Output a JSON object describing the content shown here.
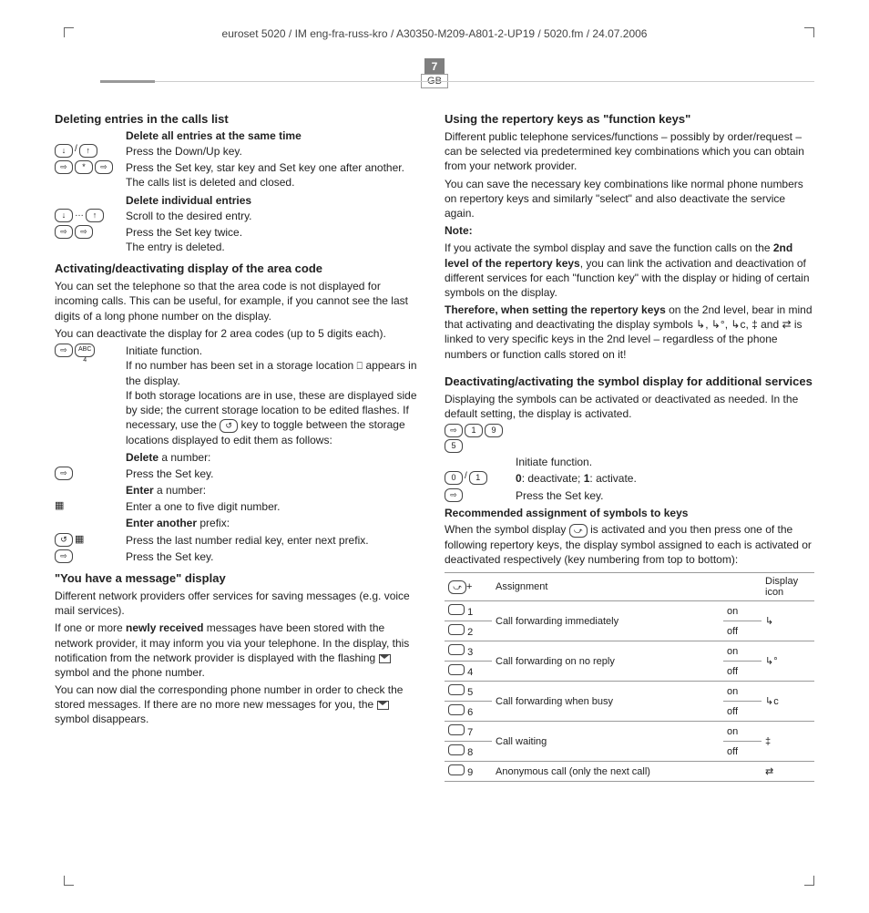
{
  "header": "euroset 5020 / IM eng-fra-russ-kro / A30350-M209-A801-2-UP19 / 5020.fm / 24.07.2006",
  "page_number": "7",
  "region": "GB",
  "left": {
    "h1": "Deleting entries in the calls list",
    "sub1": "Delete all entries at the same time",
    "r1d": "Press the Down/Up key.",
    "r2d": "Press the Set key, star key and Set key one after another.",
    "r2e": "The calls list is deleted and closed.",
    "sub2": "Delete individual entries",
    "r3d": "Scroll to the desired entry.",
    "r4d": "Press the Set key twice.",
    "r4e": "The entry is deleted.",
    "h2": "Activating/deactivating display of the area code",
    "p1": "You can set the telephone so that the area code is not displayed for incoming calls. This can be useful, for example, if you cannot see the last digits of a long phone number on the display.",
    "p2": "You can deactivate the display for 2 area codes (up to 5 digits each).",
    "r5d": "Initiate function.",
    "r5e1": "If no number has been set in a storage location",
    "r5e1b": "appears in the display.",
    "r5e2": "If both storage locations are in use, these are displayed side by side; the current storage location to be edited flashes. If necessary, use the",
    "r5e2b": "key to toggle between the storage locations displayed to edit them as follows:",
    "sub3": "Delete",
    "sub3b": " a number:",
    "r6d": "Press the Set key.",
    "sub4": "Enter",
    "sub4b": " a number:",
    "r7d": "Enter a one to five digit number.",
    "sub5": "Enter another",
    "sub5b": " prefix:",
    "r8d": "Press the last number redial key, enter next prefix.",
    "r9d": "Press the Set key.",
    "h3": "\"You have a message\" display",
    "p3": "Different network providers offer services for saving messages (e.g. voice mail services).",
    "p4a": "If one or more ",
    "p4b": "newly received",
    "p4c": " messages have been stored with the network provider, it may inform you via your telephone. In the display, this notification from the network provider is displayed with the flashing ",
    "p4d": " symbol and the phone number.",
    "p5a": "You can now dial the corresponding phone number in order to check the stored messages. If there are no more new messages for you, the ",
    "p5b": " symbol disappears."
  },
  "right": {
    "h1": "Using the repertory keys as \"function keys\"",
    "p1": "Different public telephone services/functions – possibly by order/request – can be selected via predetermined key combinations which you can obtain from your network provider.",
    "p2": "You can save the necessary key combinations like normal phone numbers on repertory keys and similarly \"select\" and also deactivate the service again.",
    "note": "Note:",
    "p3a": "If you activate the symbol display and save the function calls on the ",
    "p3b": "2nd level of the repertory keys",
    "p3c": ", you can link the activation and deactivation of different services for each \"function key\" with the display or hiding of certain symbols on the display.",
    "p4a": "Therefore, when setting the repertory keys",
    "p4b": " on the 2nd level, bear in mind that activating and deactivating the display symbols  ↳, ↳°, ↳ᴄ, ‡ and ⇄ is linked to very specific keys in the 2nd level – regardless of the phone numbers or function calls stored on it!",
    "h2": "Deactivating/activating the symbol display for additional services",
    "p5": "Displaying the symbols can be activated or deactivated as needed. In the default setting, the display is activated.",
    "r1d": "Initiate function.",
    "r2a": "0",
    "r2b": ": deactivate;   ",
    "r2c": "1",
    "r2d": ": activate.",
    "r3d": "Press the Set key.",
    "h3": "Recommended assignment of symbols to keys",
    "p6a": "When the symbol display ",
    "p6b": " is activated and you then press one of the following repertory keys, the display symbol assigned to each is activated or deactivated respectively (key numbering from top to bottom):",
    "table": {
      "hk": "+",
      "c1": "Assignment",
      "c2": "Display icon",
      "r1n": "1",
      "r1a": "Call forwarding immediately",
      "r1s": "on",
      "r1i": "↳",
      "r2n": "2",
      "r2s": "off",
      "r3n": "3",
      "r3a": "Call forwarding on no reply",
      "r3s": "on",
      "r3i": "↳°",
      "r4n": "4",
      "r4s": "off",
      "r5n": "5",
      "r5a": "Call forwarding when busy",
      "r5s": "on",
      "r5i": "↳ᴄ",
      "r6n": "6",
      "r6s": "off",
      "r7n": "7",
      "r7a": "Call waiting",
      "r7s": "on",
      "r7i": "‡",
      "r8n": "8",
      "r8s": "off",
      "r9n": "9",
      "r9a": "Anonymous call (only the next call)",
      "r9i": "⇄"
    }
  }
}
